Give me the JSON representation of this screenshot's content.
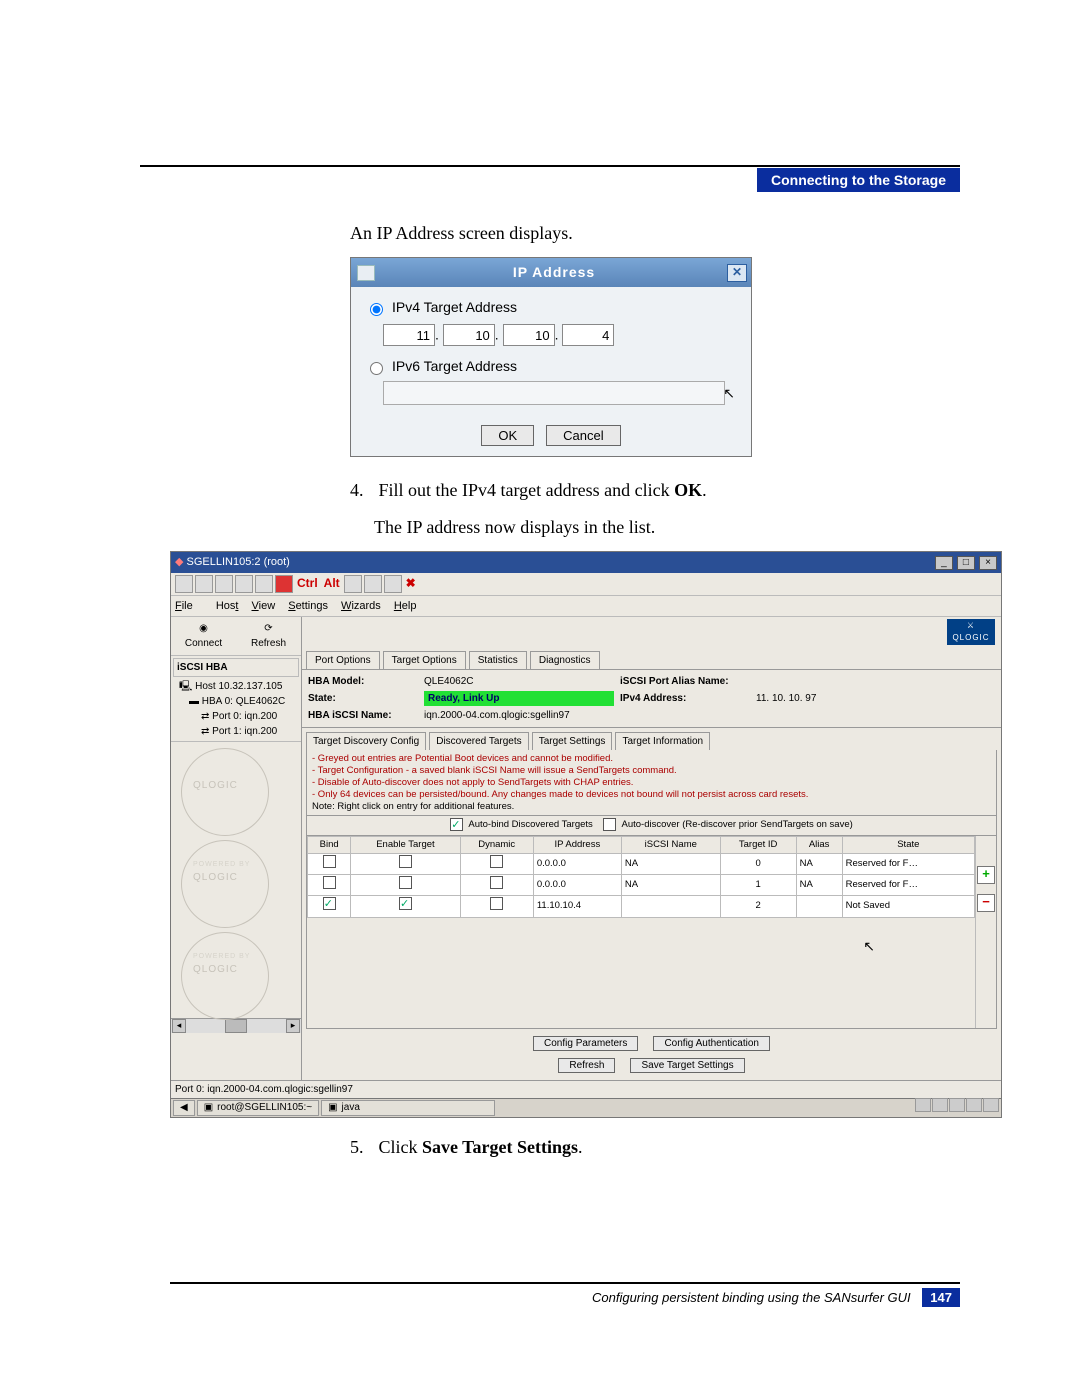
{
  "header": {
    "section": "Connecting to the Storage"
  },
  "intro": "An IP Address screen displays.",
  "ip_dialog": {
    "title": "IP Address",
    "opt_ipv4": "IPv4 Target Address",
    "opt_ipv6": "IPv6 Target Address",
    "octets": [
      "11",
      "10",
      "10",
      "4"
    ],
    "ok": "OK",
    "cancel": "Cancel",
    "close_x": "✕"
  },
  "step4": {
    "num": "4.",
    "text_a": "Fill out the IPv4 target address and click ",
    "bold": "OK",
    "text_b": ".",
    "line2": "The IP address now displays in the list."
  },
  "app": {
    "title": "SGELLIN105:2 (root)",
    "win_min": "_",
    "win_max": "□",
    "win_close": "×",
    "menu": [
      "File",
      "Host",
      "View",
      "Settings",
      "Wizards",
      "Help"
    ],
    "icon_connect": "Connect",
    "icon_refresh": "Refresh",
    "brand": "QLOGIC",
    "tree_header": "iSCSI HBA",
    "tree": {
      "host": "Host 10.32.137.105",
      "hba": "HBA 0: QLE4062C",
      "p0": "Port 0: iqn.200",
      "p1": "Port 1: iqn.200"
    },
    "wm": "QLOGIC",
    "wm_sub": "POWERED BY",
    "top_tabs": [
      "Port Options",
      "Target Options",
      "Statistics",
      "Diagnostics"
    ],
    "info": {
      "model_l": "HBA Model:",
      "model_v": "QLE4062C",
      "alias_l": "iSCSI Port Alias Name:",
      "alias_v": "",
      "state_l": "State:",
      "state_v": "Ready, Link Up",
      "ipv4_l": "IPv4 Address:",
      "ipv4_v": "11. 10. 10. 97",
      "iscsi_l": "HBA iSCSI Name:",
      "iscsi_v": "iqn.2000-04.com.qlogic:sgellin97"
    },
    "sub_tabs": [
      "Target Discovery Config",
      "Discovered Targets",
      "Target Settings",
      "Target Information"
    ],
    "notes": [
      "- Greyed out entries are Potential Boot devices and cannot be modified.",
      "- Target Configuration - a saved blank iSCSI Name will issue a SendTargets command.",
      "- Disable of Auto-discover does not apply to SendTargets with CHAP entries.",
      "- Only 64 devices can be persisted/bound. Any changes made to devices not bound will not persist across card resets."
    ],
    "notes_tail": "Note: Right click on entry for additional features.",
    "auto_bind": "Auto-bind Discovered Targets",
    "auto_disc": "Auto-discover (Re-discover prior SendTargets on save)",
    "cols": [
      "Bind",
      "Enable Target",
      "Dynamic",
      "IP Address",
      "iSCSI Name",
      "Target ID",
      "Alias",
      "State"
    ],
    "rows": [
      {
        "bind": false,
        "enable": false,
        "dynamic": false,
        "ip": "0.0.0.0",
        "name": "NA",
        "tid": "0",
        "alias": "NA",
        "state": "Reserved for F…"
      },
      {
        "bind": false,
        "enable": false,
        "dynamic": false,
        "ip": "0.0.0.0",
        "name": "NA",
        "tid": "1",
        "alias": "NA",
        "state": "Reserved for F…"
      },
      {
        "bind": true,
        "enable": true,
        "dynamic": false,
        "ip": "11.10.10.4",
        "name": "",
        "tid": "2",
        "alias": "",
        "state": "Not Saved"
      }
    ],
    "btn_config_params": "Config Parameters",
    "btn_config_auth": "Config Authentication",
    "btn_refresh": "Refresh",
    "btn_save": "Save Target Settings",
    "status": "Port 0: iqn.2000-04.com.qlogic:sgellin97",
    "taskbar": {
      "item1": "root@SGELLIN105:~",
      "item2": "java"
    }
  },
  "step5": {
    "num": "5.",
    "text_a": "Click ",
    "bold": "Save Target Settings",
    "text_b": "."
  },
  "footer": {
    "text": "Configuring persistent binding using the SANsurfer GUI",
    "page": "147"
  }
}
